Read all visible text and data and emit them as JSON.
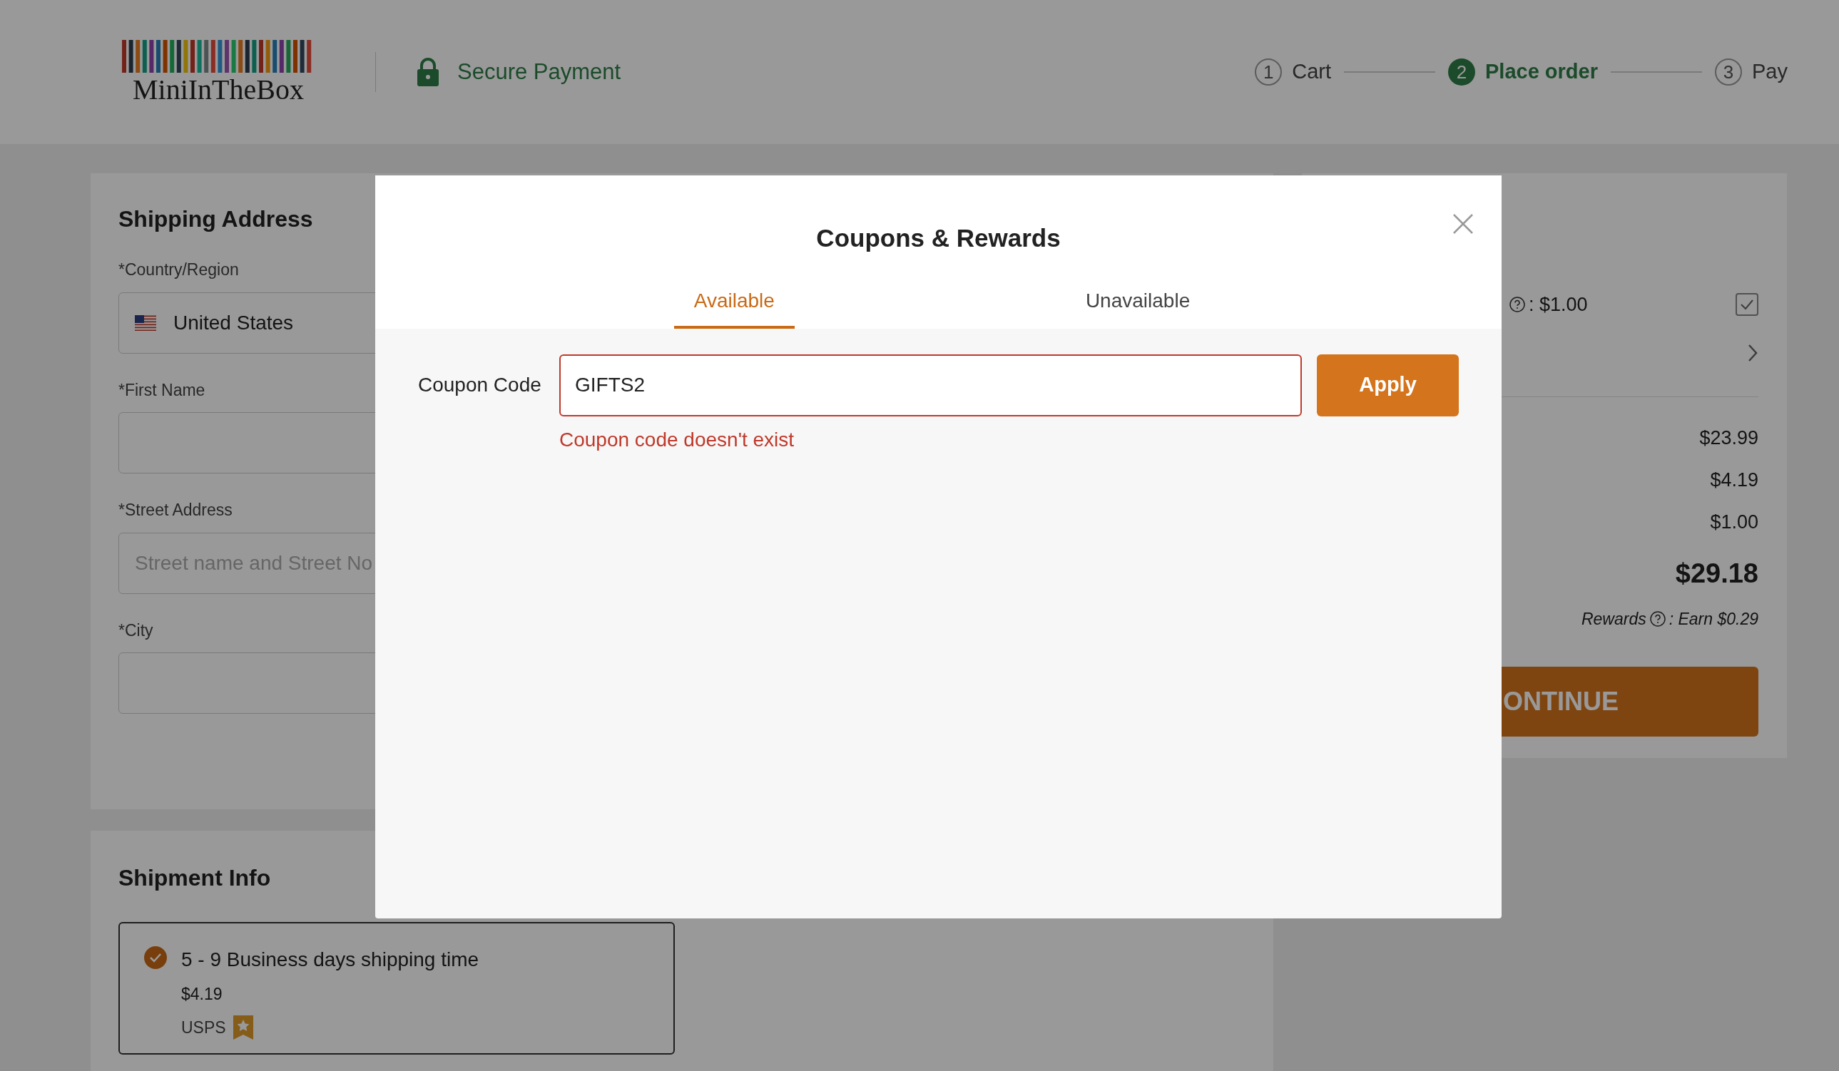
{
  "header": {
    "logo": "MiniInTheBox",
    "secure_label": "Secure Payment",
    "steps": [
      {
        "number": "1",
        "label": "Cart",
        "selected": false
      },
      {
        "number": "2",
        "label": "Place order",
        "selected": true
      },
      {
        "number": "3",
        "label": "Pay",
        "selected": false
      }
    ]
  },
  "shipping_address": {
    "title": "Shipping Address",
    "fields": [
      {
        "label": "*Country/Region",
        "value": "United States",
        "kind": "country"
      },
      {
        "label": "*First Name",
        "kind": "text"
      },
      {
        "label": "*Street Address",
        "placeholder": "Street name and Street No",
        "kind": "text"
      },
      {
        "label": "*City",
        "kind": "text"
      }
    ]
  },
  "shipment_info": {
    "title": "Shipment Info",
    "options": [
      {
        "title": "5 - 9 Business days shipping time",
        "price": "$4.19",
        "carrier": "USPS",
        "selected": true
      }
    ]
  },
  "order_summary": {
    "points_value": ": $1.00",
    "points_checked": true,
    "amounts": [
      "$23.99",
      "$4.19",
      "$1.00"
    ],
    "total": "$29.18",
    "rewards_label": "Rewards",
    "rewards_value": ": Earn $0.29",
    "continue_button": "ONTINUE"
  },
  "dialog": {
    "title": "Coupons & Rewards",
    "tabs": [
      {
        "label": "Available",
        "selected": true
      },
      {
        "label": "Unavailable",
        "selected": false
      }
    ],
    "coupon_label": "Coupon Code",
    "coupon_value": "GIFTS2",
    "apply_button": "Apply",
    "error": "Coupon code doesn't exist"
  }
}
